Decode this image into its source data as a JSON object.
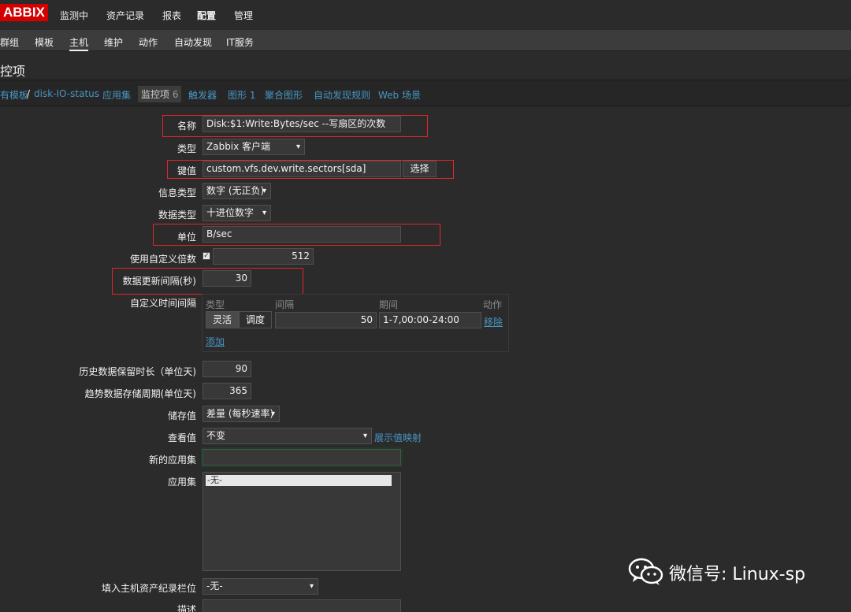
{
  "nav": {
    "logo": "ABBIX",
    "items": [
      "监测中",
      "资产记录",
      "报表",
      "配置",
      "管理"
    ]
  },
  "subnav": {
    "items": [
      "群组",
      "模板",
      "主机",
      "维护",
      "动作",
      "自动发现",
      "IT服务"
    ],
    "active_index": 2
  },
  "page_title": "控项",
  "tabs": {
    "breadcrumb_parent": "有模板",
    "separator": "/",
    "host": "disk-IO-status",
    "apps": "应用集",
    "items_label": "监控项",
    "items_count": "6",
    "triggers": "触发器",
    "graphs": "图形 1",
    "screens": "聚合图形",
    "discovery": "自动发现规则",
    "web": "Web 场景"
  },
  "form": {
    "name_label": "名称",
    "name_value": "Disk:$1:Write:Bytes/sec --写扇区的次数",
    "type_label": "类型",
    "type_value": "Zabbix 客户端",
    "key_label": "键值",
    "key_value": "custom.vfs.dev.write.sectors[sda]",
    "select_button": "选择",
    "info_type_label": "信息类型",
    "info_type_value": "数字 (无正负)",
    "data_type_label": "数据类型",
    "data_type_value": "十进位数字",
    "units_label": "单位",
    "units_value": "B/sec",
    "multiplier_label": "使用自定义倍数",
    "multiplier_checked": true,
    "multiplier_value": "512",
    "interval_label": "数据更新间隔(秒)",
    "interval_value": "30",
    "custom_interval_label": "自定义时间间隔",
    "ci_col_type": "类型",
    "ci_col_interval": "间隔",
    "ci_col_period": "期间",
    "ci_col_action": "动作",
    "ci_flexible": "灵活",
    "ci_scheduling": "调度",
    "ci_interval_value": "50",
    "ci_period_value": "1-7,00:00-24:00",
    "ci_remove": "移除",
    "ci_add": "添加",
    "history_label": "历史数据保留时长（单位天)",
    "history_value": "90",
    "trends_label": "趋势数据存储周期(单位天)",
    "trends_value": "365",
    "store_label": "储存值",
    "store_value": "差量 (每秒速率)",
    "show_label": "查看值",
    "show_value": "不变",
    "show_mapping_link": "展示值映射",
    "new_app_label": "新的应用集",
    "new_app_value": "",
    "apps_label": "应用集",
    "apps_option": "-无-",
    "inventory_label": "填入主机资产纪录栏位",
    "inventory_value": "-无-",
    "desc_label": "描述"
  },
  "watermark": {
    "text": "微信号: Linux-sp",
    "icon": "wechat-icon"
  },
  "colors": {
    "background": "#2b2b2b",
    "logo_red": "#d40000",
    "link_blue": "#4796c4",
    "highlight_red": "#e0262a"
  }
}
